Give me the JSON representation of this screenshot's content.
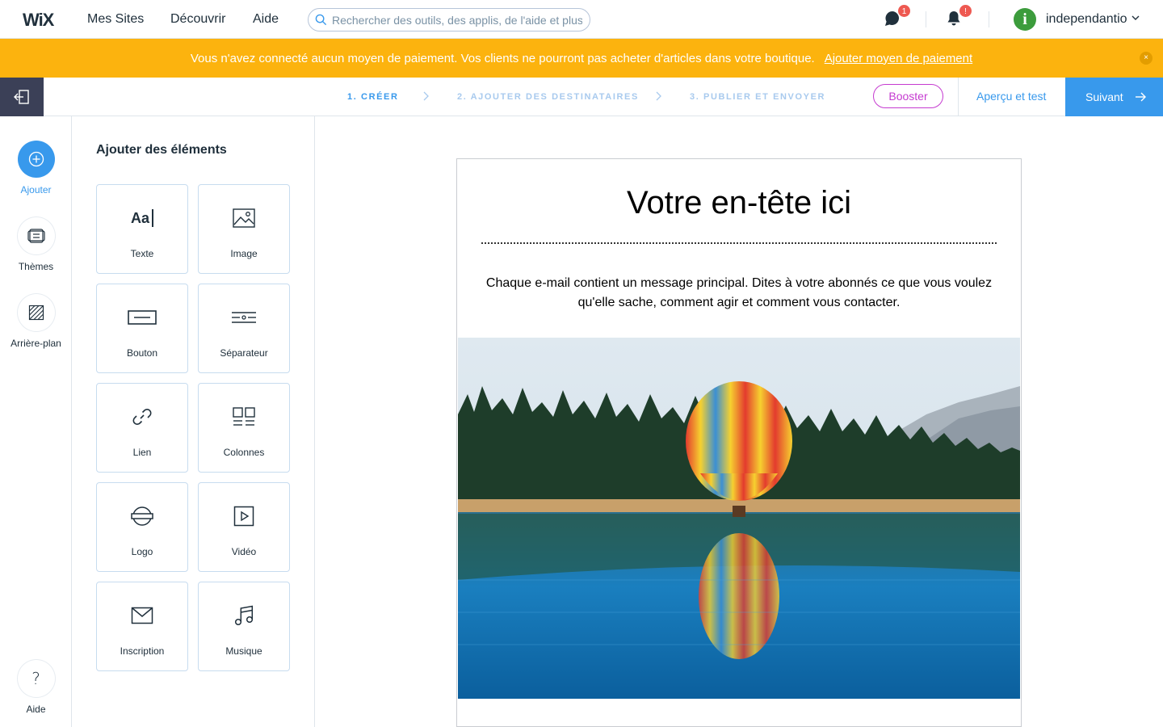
{
  "topbar": {
    "logo": "WiX",
    "nav": [
      "Mes Sites",
      "Découvrir",
      "Aide"
    ],
    "search_placeholder": "Rechercher des outils, des applis, de l'aide et plus",
    "chat_badge": "1",
    "notif_badge": "!",
    "avatar_letter": "i",
    "username": "independantio"
  },
  "banner": {
    "message": "Vous n'avez connecté aucun moyen de paiement. Vos clients ne pourront pas acheter d'articles dans votre boutique.",
    "link": "Ajouter moyen de paiement",
    "close": "×",
    "color": "#fcb30e"
  },
  "steps": {
    "items": [
      "1. CRÉER",
      "2. AJOUTER DES DESTINATAIRES",
      "3. PUBLIER ET ENVOYER"
    ],
    "booster": "Booster",
    "preview": "Aperçu et test",
    "next": "Suivant",
    "accent": "#3899ec"
  },
  "rail": {
    "items": [
      "Ajouter",
      "Thèmes",
      "Arrière-plan"
    ],
    "help": "Aide",
    "help_glyph": "?"
  },
  "panel": {
    "title": "Ajouter des éléments",
    "tiles": [
      "Texte",
      "Image",
      "Bouton",
      "Séparateur",
      "Lien",
      "Colonnes",
      "Logo",
      "Vidéo",
      "Inscription",
      "Musique"
    ],
    "text_icon_glyph": "Aa"
  },
  "email": {
    "title": "Votre en-tête ici",
    "body": "Chaque e-mail contient un message principal. Dites à votre abonnés ce que vous voulez qu'elle sache, comment agir et comment vous contacter."
  }
}
